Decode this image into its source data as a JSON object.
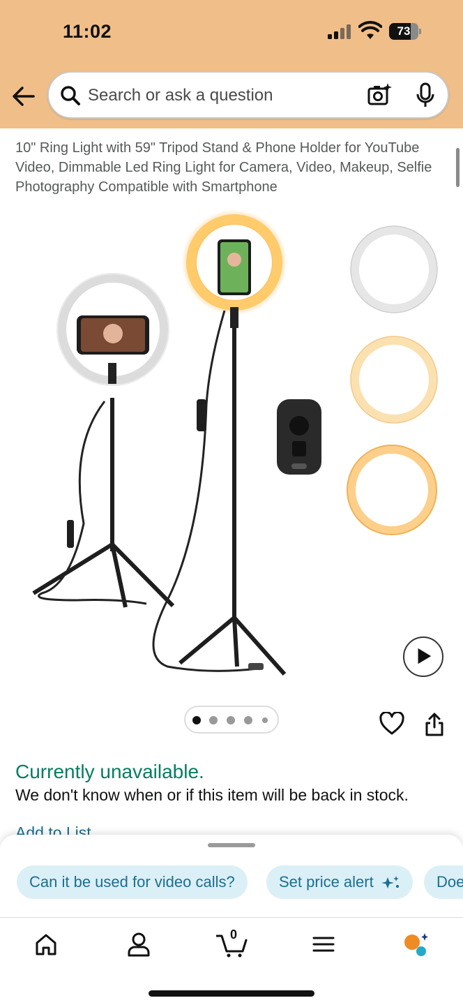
{
  "status_bar": {
    "time": "11:02",
    "battery": "73",
    "battery_level": 0.73
  },
  "search": {
    "placeholder": "Search or ask a question",
    "value": ""
  },
  "product": {
    "title": "10\" Ring Light with 59\" Tripod Stand & Phone Holder for YouTube Video, Dimmable Led Ring Light for Camera, Video, Makeup, Selfie Photography Compatible with Smartphone",
    "image_carousel": {
      "total": 5,
      "current": 1
    },
    "availability": "Currently unavailable.",
    "stock_note": "We don't know when or if this item will be back in stock.",
    "add_to_list": "Add to List"
  },
  "suggestions": [
    {
      "label": "Can it be used for video calls?"
    },
    {
      "label": "Set price alert"
    },
    {
      "label": "Doe"
    }
  ],
  "tabbar": {
    "items": [
      {
        "icon": "home-icon"
      },
      {
        "icon": "account-icon"
      },
      {
        "icon": "cart-icon",
        "count": "0"
      },
      {
        "icon": "menu-icon"
      },
      {
        "icon": "assistant-icon"
      }
    ]
  },
  "colors": {
    "header_bg": "#f0be88",
    "availability": "#067d62",
    "link": "#1a6f93",
    "chip_bg": "#dbeff6",
    "assistant_orange": "#f08a24",
    "assistant_teal": "#25a9c8"
  }
}
